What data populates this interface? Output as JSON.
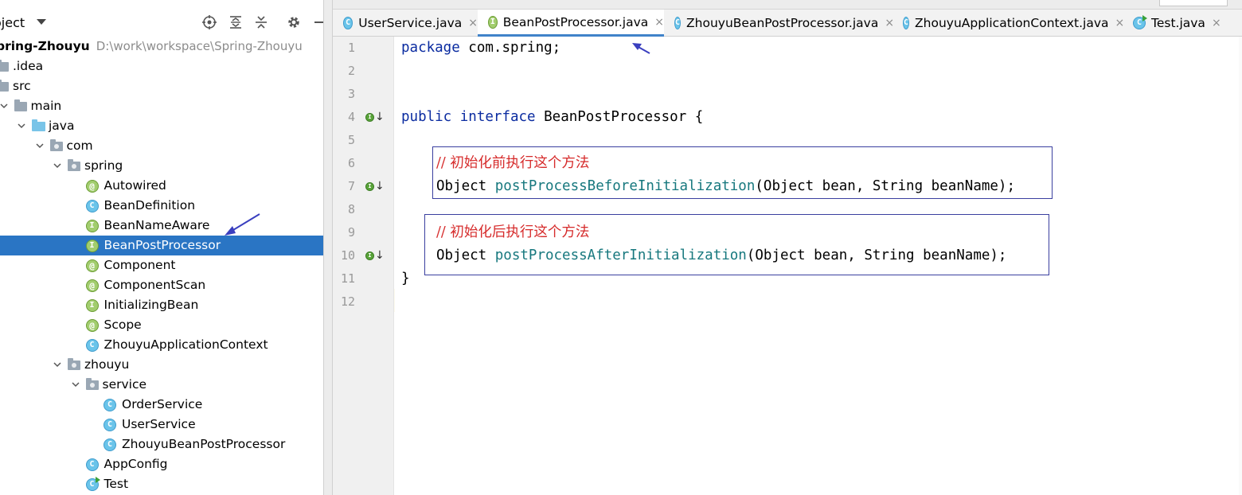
{
  "project": {
    "title": "oject",
    "root_name": "pring-Zhouyu",
    "root_path": "D:\\work\\workspace\\Spring-Zhouyu",
    "tree": [
      {
        "label": "pring-Zhouyu",
        "indent": 0,
        "icon": "none",
        "chevron": "none"
      },
      {
        "label": ".idea",
        "indent": 0,
        "icon": "folder-icon",
        "chevron": "none"
      },
      {
        "label": "src",
        "indent": 0,
        "icon": "folder-icon",
        "chevron": "none"
      },
      {
        "label": "main",
        "indent": 1,
        "icon": "folder-icon",
        "chevron": "down"
      },
      {
        "label": "java",
        "indent": 2,
        "icon": "source-folder-icon",
        "chevron": "down"
      },
      {
        "label": "com",
        "indent": 3,
        "icon": "package-icon",
        "chevron": "down"
      },
      {
        "label": "spring",
        "indent": 4,
        "icon": "package-icon",
        "chevron": "down"
      },
      {
        "label": "Autowired",
        "indent": 5,
        "icon": "annotation-icon",
        "chevron": "none"
      },
      {
        "label": "BeanDefinition",
        "indent": 5,
        "icon": "class-icon",
        "chevron": "none"
      },
      {
        "label": "BeanNameAware",
        "indent": 5,
        "icon": "interface-icon",
        "chevron": "none"
      },
      {
        "label": "BeanPostProcessor",
        "indent": 5,
        "icon": "interface-icon",
        "chevron": "none",
        "selected": true
      },
      {
        "label": "Component",
        "indent": 5,
        "icon": "annotation-icon",
        "chevron": "none"
      },
      {
        "label": "ComponentScan",
        "indent": 5,
        "icon": "annotation-icon",
        "chevron": "none"
      },
      {
        "label": "InitializingBean",
        "indent": 5,
        "icon": "interface-icon",
        "chevron": "none"
      },
      {
        "label": "Scope",
        "indent": 5,
        "icon": "annotation-icon",
        "chevron": "none"
      },
      {
        "label": "ZhouyuApplicationContext",
        "indent": 5,
        "icon": "class-icon",
        "chevron": "none"
      },
      {
        "label": "zhouyu",
        "indent": 4,
        "icon": "package-icon",
        "chevron": "down"
      },
      {
        "label": "service",
        "indent": 5,
        "icon": "package-icon",
        "chevron": "down"
      },
      {
        "label": "OrderService",
        "indent": 6,
        "icon": "class-icon",
        "chevron": "none"
      },
      {
        "label": "UserService",
        "indent": 6,
        "icon": "class-icon",
        "chevron": "none"
      },
      {
        "label": "ZhouyuBeanPostProcessor",
        "indent": 6,
        "icon": "class-icon",
        "chevron": "none"
      },
      {
        "label": "AppConfig",
        "indent": 5,
        "icon": "class-icon",
        "chevron": "none"
      },
      {
        "label": "Test",
        "indent": 5,
        "icon": "runnable-class-icon",
        "chevron": "none"
      }
    ]
  },
  "tabs": [
    {
      "label": "UserService.java",
      "icon": "class-icon",
      "active": false
    },
    {
      "label": "BeanPostProcessor.java",
      "icon": "interface-icon",
      "active": true
    },
    {
      "label": "ZhouyuBeanPostProcessor.java",
      "icon": "class-icon",
      "active": false
    },
    {
      "label": "ZhouyuApplicationContext.java",
      "icon": "class-icon",
      "active": false
    },
    {
      "label": "Test.java",
      "icon": "runnable-class-icon",
      "active": false
    }
  ],
  "tab_close_glyph": "×",
  "editor": {
    "current_line": 12,
    "lines": [
      {
        "n": "1",
        "segments": [
          [
            "kw",
            "package"
          ],
          [
            "plain",
            " com.spring;"
          ]
        ]
      },
      {
        "n": "2",
        "segments": []
      },
      {
        "n": "3",
        "segments": []
      },
      {
        "n": "4",
        "segments": [
          [
            "kw",
            "public"
          ],
          [
            "plain",
            " "
          ],
          [
            "kw",
            "interface"
          ],
          [
            "plain",
            " BeanPostProcessor {"
          ]
        ],
        "gutter_mark": true
      },
      {
        "n": "5",
        "segments": []
      },
      {
        "n": "6",
        "segments": [
          [
            "comment",
            "// 初始化前执行这个方法"
          ]
        ]
      },
      {
        "n": "7",
        "segments": [
          [
            "plain",
            "Object "
          ],
          [
            "method",
            "postProcessBeforeInitialization"
          ],
          [
            "plain",
            "(Object bean, String beanName);"
          ]
        ],
        "gutter_mark": true
      },
      {
        "n": "8",
        "segments": []
      },
      {
        "n": "9",
        "segments": [
          [
            "comment",
            "// 初始化后执行这个方法"
          ]
        ]
      },
      {
        "n": "10",
        "segments": [
          [
            "plain",
            "Object "
          ],
          [
            "method",
            "postProcessAfterInitialization"
          ],
          [
            "plain",
            "(Object bean, String beanName);"
          ]
        ],
        "gutter_mark": true
      },
      {
        "n": "11",
        "segments": [
          [
            "plain",
            "}"
          ]
        ]
      },
      {
        "n": "12",
        "segments": []
      }
    ]
  },
  "gutter_mark_letter": "I",
  "gutter_mark_arrow": "↓",
  "colors": {
    "keyword": "#0a2ba0",
    "method": "#17787e",
    "comment": "#d62b2b",
    "selection": "#2a75c4",
    "callout_border": "#3a3f9f"
  }
}
